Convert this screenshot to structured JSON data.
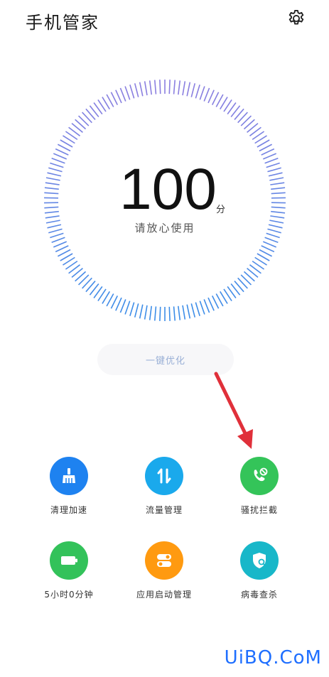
{
  "header": {
    "title": "手机管家"
  },
  "score": {
    "value": "100",
    "unit": "分",
    "status": "请放心使用"
  },
  "optimize_button": {
    "label": "一键优化"
  },
  "tools": [
    {
      "label": "清理加速",
      "color": "#1e82f0",
      "icon": "broom-icon"
    },
    {
      "label": "流量管理",
      "color": "#1aa9ec",
      "icon": "data-transfer-icon"
    },
    {
      "label": "骚扰拦截",
      "color": "#34c459",
      "icon": "phone-block-icon"
    },
    {
      "label": "5小时0分钟",
      "color": "#33c25a",
      "icon": "battery-icon"
    },
    {
      "label": "应用启动管理",
      "color": "#ff9a10",
      "icon": "toggle-icon"
    },
    {
      "label": "病毒查杀",
      "color": "#18b7c9",
      "icon": "shield-search-icon"
    }
  ],
  "watermark": "UiBQ.CoM"
}
